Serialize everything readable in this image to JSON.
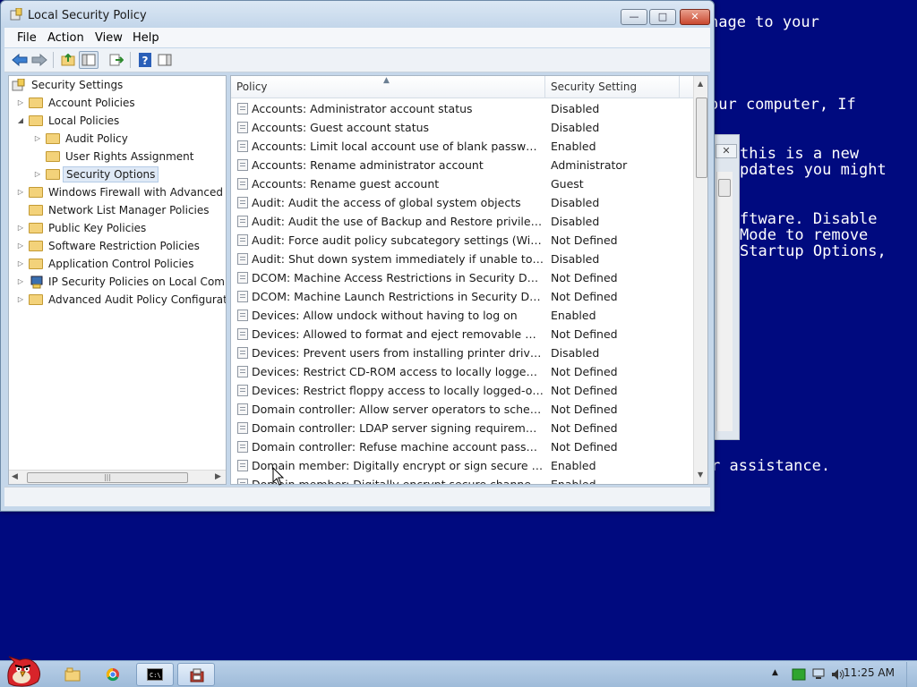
{
  "window": {
    "title": "Local Security Policy",
    "min_label": "—",
    "max_label": "□",
    "close_label": "✕"
  },
  "menu": {
    "items": [
      "File",
      "Action",
      "View",
      "Help"
    ]
  },
  "tree": {
    "items": [
      {
        "label": "Security Settings"
      },
      {
        "label": "Account Policies"
      },
      {
        "label": "Local Policies"
      },
      {
        "label": "Audit Policy"
      },
      {
        "label": "User Rights Assignment"
      },
      {
        "label": "Security Options"
      },
      {
        "label": "Windows Firewall with Advanced Se"
      },
      {
        "label": "Network List Manager Policies"
      },
      {
        "label": "Public Key Policies"
      },
      {
        "label": "Software Restriction Policies"
      },
      {
        "label": "Application Control Policies"
      },
      {
        "label": "IP Security Policies on Local Compu"
      },
      {
        "label": "Advanced Audit Policy Configuration"
      }
    ]
  },
  "list": {
    "col_policy": "Policy",
    "col_setting": "Security Setting",
    "rows": [
      {
        "policy": "Accounts: Administrator account status",
        "setting": "Disabled"
      },
      {
        "policy": "Accounts: Guest account status",
        "setting": "Disabled"
      },
      {
        "policy": "Accounts: Limit local account use of blank passwords to console logon only",
        "setting": "Enabled"
      },
      {
        "policy": "Accounts: Rename administrator account",
        "setting": "Administrator"
      },
      {
        "policy": "Accounts: Rename guest account",
        "setting": "Guest"
      },
      {
        "policy": "Audit: Audit the access of global system objects",
        "setting": "Disabled"
      },
      {
        "policy": "Audit: Audit the use of Backup and Restore privilege",
        "setting": "Disabled"
      },
      {
        "policy": "Audit: Force audit policy subcategory settings (Windows Vista or later)",
        "setting": "Not Defined"
      },
      {
        "policy": "Audit: Shut down system immediately if unable to log security audits",
        "setting": "Disabled"
      },
      {
        "policy": "DCOM: Machine Access Restrictions in Security Descriptor",
        "setting": "Not Defined"
      },
      {
        "policy": "DCOM: Machine Launch Restrictions in Security Descriptor",
        "setting": "Not Defined"
      },
      {
        "policy": "Devices: Allow undock without having to log on",
        "setting": "Enabled"
      },
      {
        "policy": "Devices: Allowed to format and eject removable media",
        "setting": "Not Defined"
      },
      {
        "policy": "Devices: Prevent users from installing printer drivers",
        "setting": "Disabled"
      },
      {
        "policy": "Devices: Restrict CD-ROM access to locally logged-on user only",
        "setting": "Not Defined"
      },
      {
        "policy": "Devices: Restrict floppy access to locally logged-on user only",
        "setting": "Not Defined"
      },
      {
        "policy": "Domain controller: Allow server operators to schedule tasks",
        "setting": "Not Defined"
      },
      {
        "policy": "Domain controller: LDAP server signing requirements",
        "setting": "Not Defined"
      },
      {
        "policy": "Domain controller: Refuse machine account password changes",
        "setting": "Not Defined"
      },
      {
        "policy": "Domain member: Digitally encrypt or sign secure channel data (always)",
        "setting": "Enabled"
      },
      {
        "policy": "Domain member: Digitally encrypt secure channel data (when possible)",
        "setting": "Enabled"
      }
    ]
  },
  "bsod": {
    "lines": [
      "nage to your",
      "our computer, If",
      "this is a new",
      "pdates you might",
      "ftware. Disable",
      "Mode to remove",
      "Startup Options,",
      "r assistance."
    ]
  },
  "taskbar": {
    "clock": "11:25 AM"
  },
  "colors": {
    "bsod_background": "#000a7f",
    "window_frame": "#c5d7ea",
    "close_button": "#c9482f"
  }
}
